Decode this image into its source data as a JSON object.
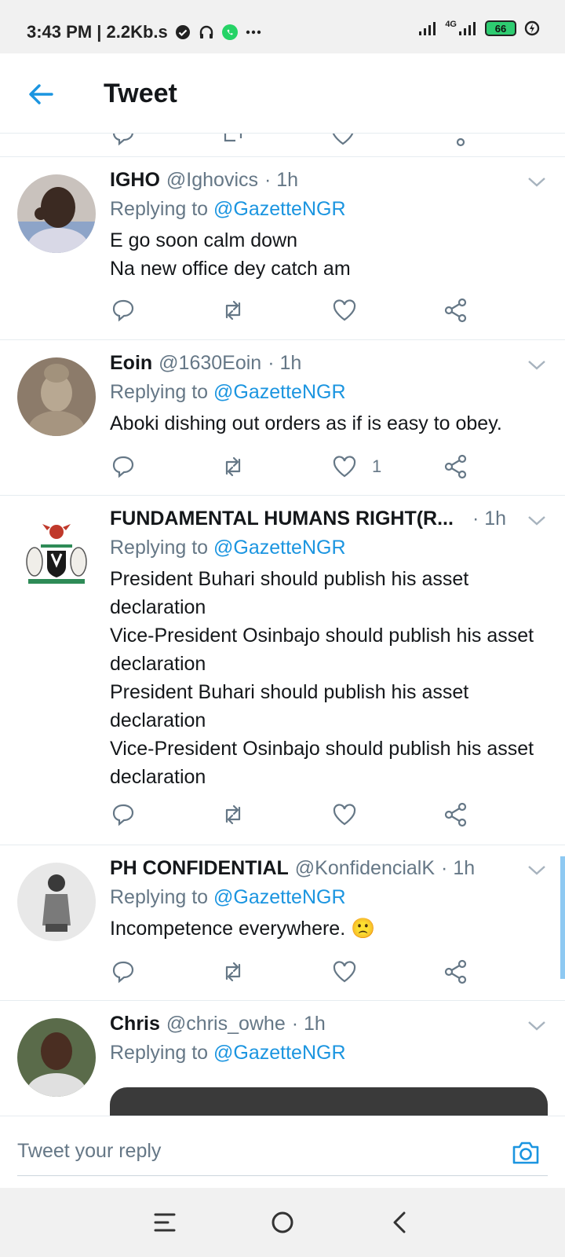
{
  "status_bar": {
    "time_info": "3:43 PM | 2.2Kb.s",
    "network_label": "4G",
    "battery_level": "66"
  },
  "header": {
    "title": "Tweet"
  },
  "colors": {
    "accent": "#1b95e0",
    "secondary_text": "#657786",
    "divider": "#e6ecf0"
  },
  "tweets": [
    {
      "name": "IGHO",
      "handle": "@Ighovics",
      "time": "· 1h",
      "replying_prefix": "Replying to",
      "mention": "@GazetteNGR",
      "text": "E go soon calm down\nNa new office dey catch am",
      "like_count": ""
    },
    {
      "name": "Eoin",
      "handle": "@1630Eoin",
      "time": "· 1h",
      "replying_prefix": "Replying to",
      "mention": "@GazetteNGR",
      "text": "Aboki dishing out orders as if is easy to obey.",
      "like_count": "1"
    },
    {
      "name": "FUNDAMENTAL HUMANS RIGHT(R...",
      "handle": "",
      "time": "· 1h",
      "replying_prefix": "Replying to",
      "mention": "@GazetteNGR",
      "text": "President Buhari should publish his asset declaration\nVice-President Osinbajo should publish his asset declaration\nPresident Buhari should publish his asset declaration\nVice-President Osinbajo should publish his asset declaration",
      "like_count": ""
    },
    {
      "name": "PH CONFIDENTIAL",
      "handle": "@KonfidencialK",
      "time": "· 1h",
      "replying_prefix": "Replying to",
      "mention": "@GazetteNGR",
      "text": "Incompetence everywhere. 🙁",
      "like_count": ""
    },
    {
      "name": "Chris",
      "handle": "@chris_owhe",
      "time": "· 1h",
      "replying_prefix": "Replying to",
      "mention": "@GazetteNGR",
      "text": "",
      "like_count": ""
    }
  ],
  "composer": {
    "placeholder": "Tweet your reply"
  },
  "icons": {
    "back": "back-arrow-icon",
    "reply": "reply-icon",
    "retweet": "retweet-icon",
    "like": "heart-icon",
    "share": "share-icon",
    "camera": "camera-icon",
    "chevron": "chevron-down-icon"
  }
}
